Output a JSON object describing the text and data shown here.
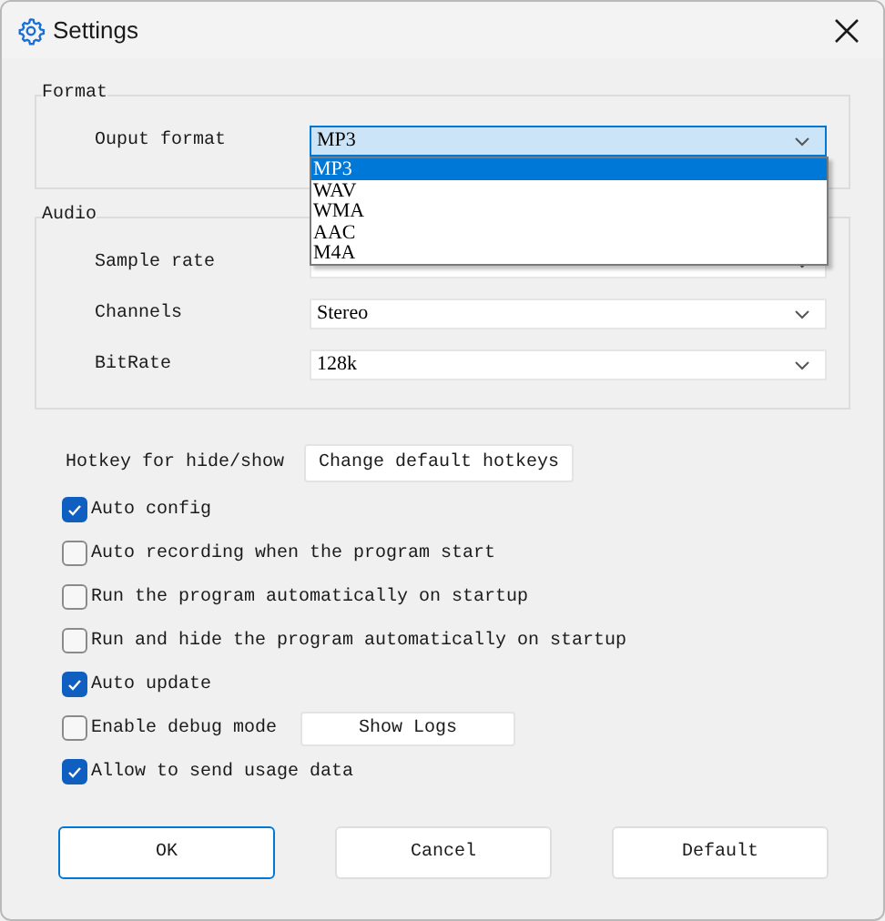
{
  "window": {
    "title": "Settings"
  },
  "format": {
    "title": "Format",
    "fields": [
      {
        "label": "Ouput format",
        "value": "MP3",
        "focused": true
      }
    ]
  },
  "format_dropdown": {
    "options": [
      {
        "label": "MP3",
        "selected": true
      },
      {
        "label": "WAV",
        "selected": false
      },
      {
        "label": "WMA",
        "selected": false
      },
      {
        "label": "AAC",
        "selected": false
      },
      {
        "label": "M4A",
        "selected": false
      }
    ]
  },
  "audio": {
    "title": "Audio",
    "fields": [
      {
        "label": "Sample rate",
        "focused": false
      },
      {
        "label": "Channels",
        "value": "Stereo",
        "focused": false
      },
      {
        "label": "BitRate",
        "value": "128k",
        "focused": false
      }
    ]
  },
  "hotkey": {
    "label": "Hotkey for hide/show",
    "button": "Change default hotkeys"
  },
  "options": [
    {
      "label": "Auto config",
      "checked": true
    },
    {
      "label": "Auto recording when the program start",
      "checked": false
    },
    {
      "label": "Run the program automatically on startup",
      "checked": false
    },
    {
      "label": "Run and hide the program automatically on startup",
      "checked": false
    },
    {
      "label": "Auto update",
      "checked": true
    },
    {
      "label": "Enable debug mode",
      "checked": false,
      "button": "Show Logs"
    },
    {
      "label": "Allow to send usage data",
      "checked": true
    }
  ],
  "buttons": [
    {
      "label": "OK",
      "focused": true
    },
    {
      "label": "Cancel",
      "focused": false
    },
    {
      "label": "Default",
      "focused": false
    }
  ]
}
